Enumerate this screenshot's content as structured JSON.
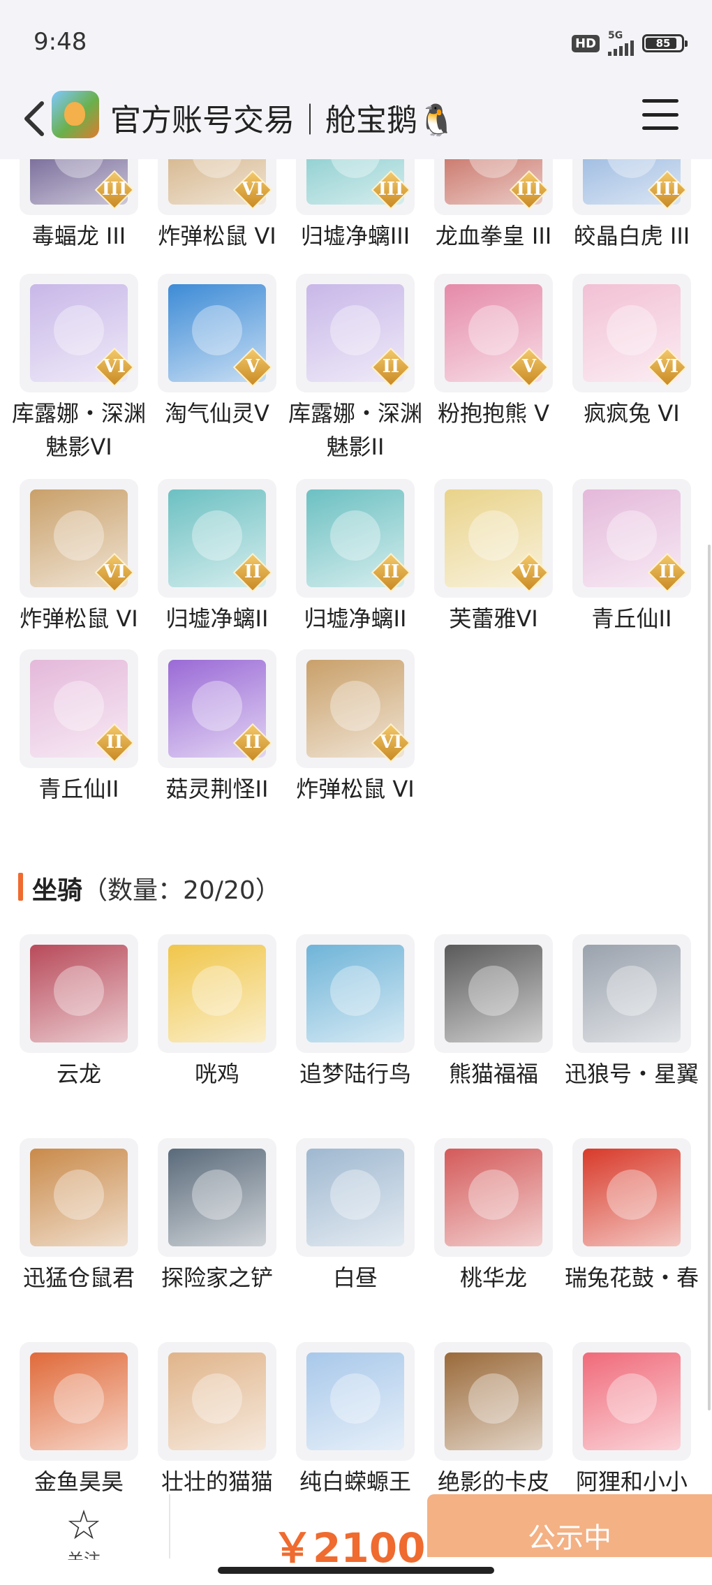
{
  "status_bar": {
    "time": "9:48",
    "hd": "HD",
    "network": "5G",
    "battery": "85"
  },
  "header": {
    "title": "官方账号交易｜舱宝鹅🐧",
    "back_icon": "back-arrow-icon",
    "menu_icon": "hamburger-menu-icon"
  },
  "pets": [
    {
      "name": "毒蝠龙 III",
      "tier": "III",
      "color": "#4b3a78"
    },
    {
      "name": "炸弹松鼠 VI",
      "tier": "VI",
      "color": "#c9a06a"
    },
    {
      "name": "归墟净螭III",
      "tier": "III",
      "color": "#6cc0c2"
    },
    {
      "name": "龙血拳皇 III",
      "tier": "III",
      "color": "#b94a3a"
    },
    {
      "name": "皎晶白虎 III",
      "tier": "III",
      "color": "#7fa6d8"
    },
    {
      "name": "库露娜・深渊魅影VI",
      "tier": "VI",
      "color": "#c8b7e8"
    },
    {
      "name": "淘气仙灵V",
      "tier": "V",
      "color": "#3d8bd6"
    },
    {
      "name": "库露娜・深渊魅影II",
      "tier": "II",
      "color": "#c8b7e8"
    },
    {
      "name": "粉抱抱熊 V",
      "tier": "V",
      "color": "#e58aa8"
    },
    {
      "name": "疯疯兔 VI",
      "tier": "VI",
      "color": "#f2c0d4"
    },
    {
      "name": "炸弹松鼠 VI",
      "tier": "VI",
      "color": "#c9a06a"
    },
    {
      "name": "归墟净螭II",
      "tier": "II",
      "color": "#6cc0c2"
    },
    {
      "name": "归墟净螭II",
      "tier": "II",
      "color": "#6cc0c2"
    },
    {
      "name": "芙蕾雅VI",
      "tier": "VI",
      "color": "#e9d38a"
    },
    {
      "name": "青丘仙II",
      "tier": "II",
      "color": "#e4b8da"
    },
    {
      "name": "青丘仙II",
      "tier": "II",
      "color": "#e4b8da"
    },
    {
      "name": "菇灵荆怪II",
      "tier": "II",
      "color": "#9a6ad6"
    },
    {
      "name": "炸弹松鼠 VI",
      "tier": "VI",
      "color": "#c9a06a"
    }
  ],
  "mounts_section": {
    "title": "坐骑",
    "count": "（数量：20/20）"
  },
  "mounts": [
    {
      "name": "云龙",
      "color": "#b84a5a"
    },
    {
      "name": "咣鸡",
      "color": "#f0c64a"
    },
    {
      "name": "追梦陆行鸟",
      "color": "#6fb4d8"
    },
    {
      "name": "熊猫福福",
      "color": "#5a5a5a"
    },
    {
      "name": "迅狼号・星翼",
      "color": "#9aa2ad"
    },
    {
      "name": "迅猛仓鼠君",
      "color": "#c98a4a"
    },
    {
      "name": "探险家之铲",
      "color": "#5a6a7a"
    },
    {
      "name": "白昼",
      "color": "#9fb8d0"
    },
    {
      "name": "桃华龙",
      "color": "#d45a5a"
    },
    {
      "name": "瑞兔花鼓・春",
      "color": "#d83a2a"
    },
    {
      "name": "金鱼昊昊",
      "color": "#e06a3a"
    },
    {
      "name": "壮壮的猫猫",
      "color": "#e0b48a"
    },
    {
      "name": "纯白蝾螈王",
      "color": "#a8c8ea"
    },
    {
      "name": "绝影的卡皮",
      "color": "#9a6a3a"
    },
    {
      "name": "阿狸和小小",
      "color": "#f06a7a"
    }
  ],
  "bottom_bar": {
    "follow_label": "关注",
    "price": "￥2100",
    "status": "公示中"
  }
}
